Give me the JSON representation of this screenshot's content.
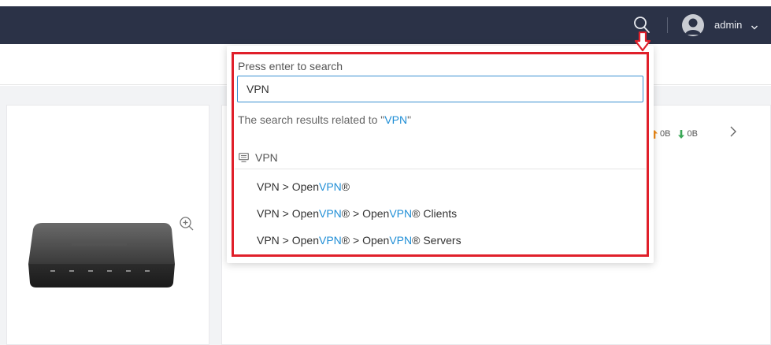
{
  "header": {
    "username": "admin",
    "search_icon": "search-icon",
    "avatar_icon": "user-avatar-icon",
    "dropdown_icon": "chevron-down-icon",
    "background": "#2b3247"
  },
  "device_card": {
    "zoom_icon": "zoom-in-icon"
  },
  "traffic": {
    "upload_value": "0B",
    "download_value": "0B",
    "upload_color": "#f08c1a",
    "download_color": "#3aa757",
    "next_icon": "chevron-right-icon"
  },
  "search_dropdown": {
    "hint": "Press enter to search",
    "query": "VPN",
    "results_caption_prefix": "The search results related to \"",
    "results_caption_keyword": "VPN",
    "results_caption_suffix": "\"",
    "group_label": "VPN",
    "group_icon": "monitor-icon",
    "results": [
      {
        "parts": [
          "VPN > Open",
          "VPN",
          "®"
        ]
      },
      {
        "parts": [
          "VPN > Open",
          "VPN",
          "® > Open",
          "VPN",
          "® Clients"
        ]
      },
      {
        "parts": [
          "VPN > Open",
          "VPN",
          "® > Open",
          "VPN",
          "® Servers"
        ]
      }
    ],
    "keyword_color": "#1f8ed6",
    "annotation_color": "#e01f2a"
  }
}
